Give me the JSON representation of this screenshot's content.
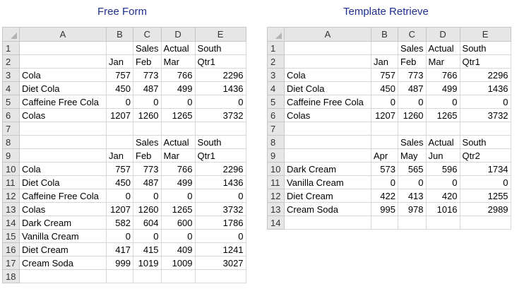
{
  "free_form": {
    "caption": "Free Form",
    "columns": [
      "A",
      "B",
      "C",
      "D",
      "E"
    ],
    "rows": [
      {
        "n": "1",
        "cells": [
          "",
          "",
          "Sales",
          "Actual",
          "South"
        ]
      },
      {
        "n": "2",
        "cells": [
          "",
          "Jan",
          "Feb",
          "Mar",
          "Qtr1"
        ]
      },
      {
        "n": "3",
        "cells": [
          "Cola",
          "757",
          "773",
          "766",
          "2296"
        ]
      },
      {
        "n": "4",
        "cells": [
          "Diet Cola",
          "450",
          "487",
          "499",
          "1436"
        ]
      },
      {
        "n": "5",
        "cells": [
          "Caffeine Free Cola",
          "0",
          "0",
          "0",
          "0"
        ]
      },
      {
        "n": "6",
        "cells": [
          "Colas",
          "1207",
          "1260",
          "1265",
          "3732"
        ]
      },
      {
        "n": "7",
        "cells": [
          "",
          "",
          "",
          "",
          ""
        ]
      },
      {
        "n": "8",
        "cells": [
          "",
          "",
          "Sales",
          "Actual",
          "South"
        ]
      },
      {
        "n": "9",
        "cells": [
          "",
          "Jan",
          "Feb",
          "Mar",
          "Qtr1"
        ]
      },
      {
        "n": "10",
        "cells": [
          "Cola",
          "757",
          "773",
          "766",
          "2296"
        ]
      },
      {
        "n": "11",
        "cells": [
          "Diet Cola",
          "450",
          "487",
          "499",
          "1436"
        ]
      },
      {
        "n": "12",
        "cells": [
          "Caffeine Free Cola",
          "0",
          "0",
          "0",
          "0"
        ]
      },
      {
        "n": "13",
        "cells": [
          "Colas",
          "1207",
          "1260",
          "1265",
          "3732"
        ]
      },
      {
        "n": "14",
        "cells": [
          "Dark Cream",
          "582",
          "604",
          "600",
          "1786"
        ]
      },
      {
        "n": "15",
        "cells": [
          "Vanilla Cream",
          "0",
          "0",
          "0",
          "0"
        ]
      },
      {
        "n": "16",
        "cells": [
          "Diet Cream",
          "417",
          "415",
          "409",
          "1241"
        ]
      },
      {
        "n": "17",
        "cells": [
          "Cream Soda",
          "999",
          "1019",
          "1009",
          "3027"
        ]
      },
      {
        "n": "18",
        "cells": [
          "",
          "",
          "",
          "",
          ""
        ]
      }
    ]
  },
  "template_retrieve": {
    "caption": "Template Retrieve",
    "columns": [
      "A",
      "B",
      "C",
      "D",
      "E"
    ],
    "rows": [
      {
        "n": "1",
        "cells": [
          "",
          "",
          "Sales",
          "Actual",
          "South"
        ]
      },
      {
        "n": "2",
        "cells": [
          "",
          "Jan",
          "Feb",
          "Mar",
          "Qtr1"
        ]
      },
      {
        "n": "3",
        "cells": [
          "Cola",
          "757",
          "773",
          "766",
          "2296"
        ]
      },
      {
        "n": "4",
        "cells": [
          "Diet Cola",
          "450",
          "487",
          "499",
          "1436"
        ]
      },
      {
        "n": "5",
        "cells": [
          "Caffeine Free Cola",
          "0",
          "0",
          "0",
          "0"
        ]
      },
      {
        "n": "6",
        "cells": [
          "Colas",
          "1207",
          "1260",
          "1265",
          "3732"
        ]
      },
      {
        "n": "7",
        "cells": [
          "",
          "",
          "",
          "",
          ""
        ]
      },
      {
        "n": "8",
        "cells": [
          "",
          "",
          "Sales",
          "Actual",
          "South"
        ]
      },
      {
        "n": "9",
        "cells": [
          "",
          "Apr",
          "May",
          "Jun",
          "Qtr2"
        ]
      },
      {
        "n": "10",
        "cells": [
          "Dark Cream",
          "573",
          "565",
          "596",
          "1734"
        ]
      },
      {
        "n": "11",
        "cells": [
          "Vanilla Cream",
          "0",
          "0",
          "0",
          "0"
        ]
      },
      {
        "n": "12",
        "cells": [
          "Diet Cream",
          "422",
          "413",
          "420",
          "1255"
        ]
      },
      {
        "n": "13",
        "cells": [
          "Cream Soda",
          "995",
          "978",
          "1016",
          "2989"
        ]
      },
      {
        "n": "14",
        "cells": [
          "",
          "",
          "",
          "",
          ""
        ]
      }
    ]
  }
}
